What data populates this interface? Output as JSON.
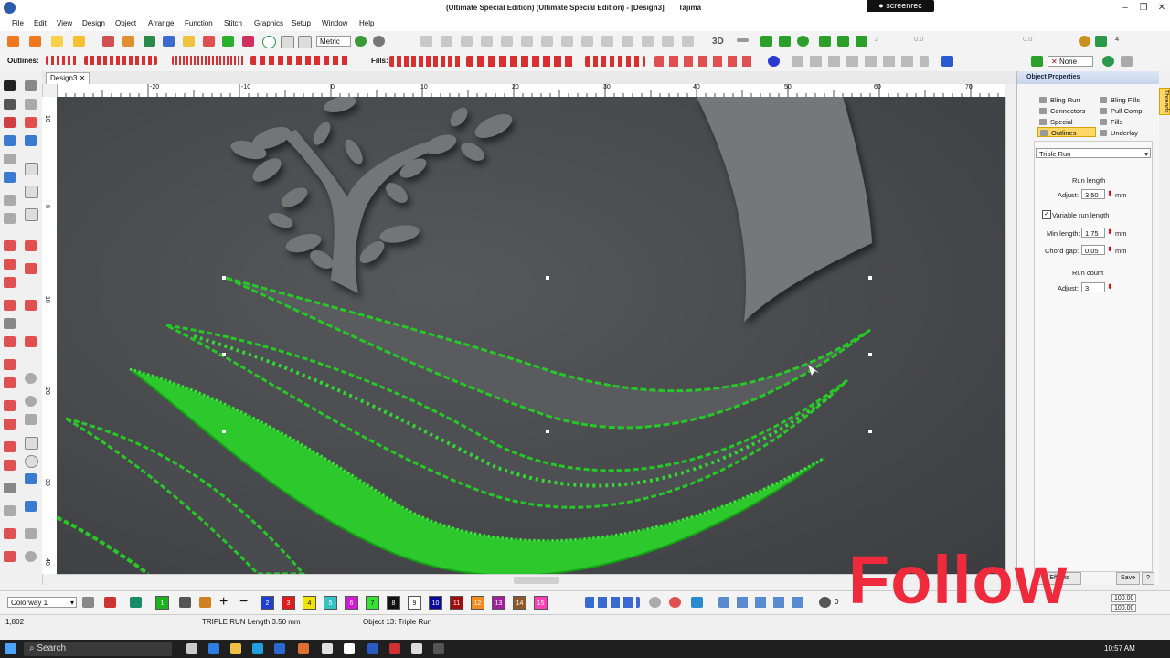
{
  "window": {
    "title": "(Ultimate Special Edition) (Ultimate Special Edition) - [Design3]",
    "machine": "Tajima",
    "recorder_badge": "screenrec"
  },
  "menu": [
    "File",
    "Edit",
    "View",
    "Design",
    "Object",
    "Arrange",
    "Function",
    "Stitch",
    "Graphics",
    "Setup",
    "Window",
    "Help"
  ],
  "toolbar": {
    "units": "Metric",
    "zoom_label": "3D",
    "outlines_label": "Outlines:",
    "fills_label": "Fills:",
    "stitch_count_a": "2",
    "stitch_count_b": "4",
    "value_a": "0.0",
    "value_b": "0.0",
    "applique_label": "None"
  },
  "document_tab": "Design3",
  "ruler": {
    "top": [
      "-20",
      "-10",
      "0",
      "10",
      "20",
      "30",
      "40",
      "50",
      "60",
      "70"
    ],
    "left": [
      "10",
      "0",
      "10",
      "20",
      "30",
      "40"
    ]
  },
  "object_properties": {
    "header": "Object Properties",
    "tabs": [
      {
        "label": "Bling Run",
        "active": false
      },
      {
        "label": "Bling Fills",
        "active": false
      },
      {
        "label": "Connectors",
        "active": false
      },
      {
        "label": "Pull Comp",
        "active": false
      },
      {
        "label": "Special",
        "active": false
      },
      {
        "label": "Fills",
        "active": false
      },
      {
        "label": "Outlines",
        "active": true
      },
      {
        "label": "Underlay",
        "active": false
      }
    ],
    "stitch_type": "Triple Run",
    "run_length_title": "Run length",
    "adjust_label": "Adjust:",
    "adjust_value": "3.50",
    "unit": "mm",
    "variable_run_length_label": "Variable run length",
    "variable_run_length_checked": true,
    "min_length_label": "Min length:",
    "min_length_value": "1.75",
    "chord_gap_label": "Chord gap:",
    "chord_gap_value": "0.05",
    "run_count_title": "Run count",
    "run_count_adjust_label": "Adjust:",
    "run_count_value": "3",
    "effects_button": "Effects",
    "save_button": "Save",
    "help_button": "?"
  },
  "side_tab": "Threads",
  "colorbar": {
    "palette": "Colorway 1",
    "swatches": [
      {
        "n": "1",
        "color": "#1db11d"
      },
      {
        "n": "2",
        "color": "#1f3fd1"
      },
      {
        "n": "3",
        "color": "#e11b1b"
      },
      {
        "n": "4",
        "color": "#f0e400"
      },
      {
        "n": "5",
        "color": "#33c4c4"
      },
      {
        "n": "6",
        "color": "#d21ad2"
      },
      {
        "n": "7",
        "color": "#33e233"
      },
      {
        "n": "8",
        "color": "#111111"
      },
      {
        "n": "9",
        "color": "#ffffff"
      },
      {
        "n": "10",
        "color": "#0a0aa0"
      },
      {
        "n": "11",
        "color": "#a00d0d"
      },
      {
        "n": "12",
        "color": "#f28c1c"
      },
      {
        "n": "13",
        "color": "#a01fa0"
      },
      {
        "n": "14",
        "color": "#8c5a2a"
      },
      {
        "n": "15",
        "color": "#ff3fb4"
      }
    ],
    "layer_count": "0",
    "scale_a": "100.00",
    "scale_b": "100.00"
  },
  "status": {
    "coords": "1,802",
    "stitch_info": "TRIPLE RUN Length   3.50 mm",
    "object_info": "Object 13: Triple Run"
  },
  "taskbar": {
    "search": "Search",
    "time": "10:57 AM"
  },
  "overlay": {
    "text": "Follow",
    "color": "#ee2a3c"
  }
}
